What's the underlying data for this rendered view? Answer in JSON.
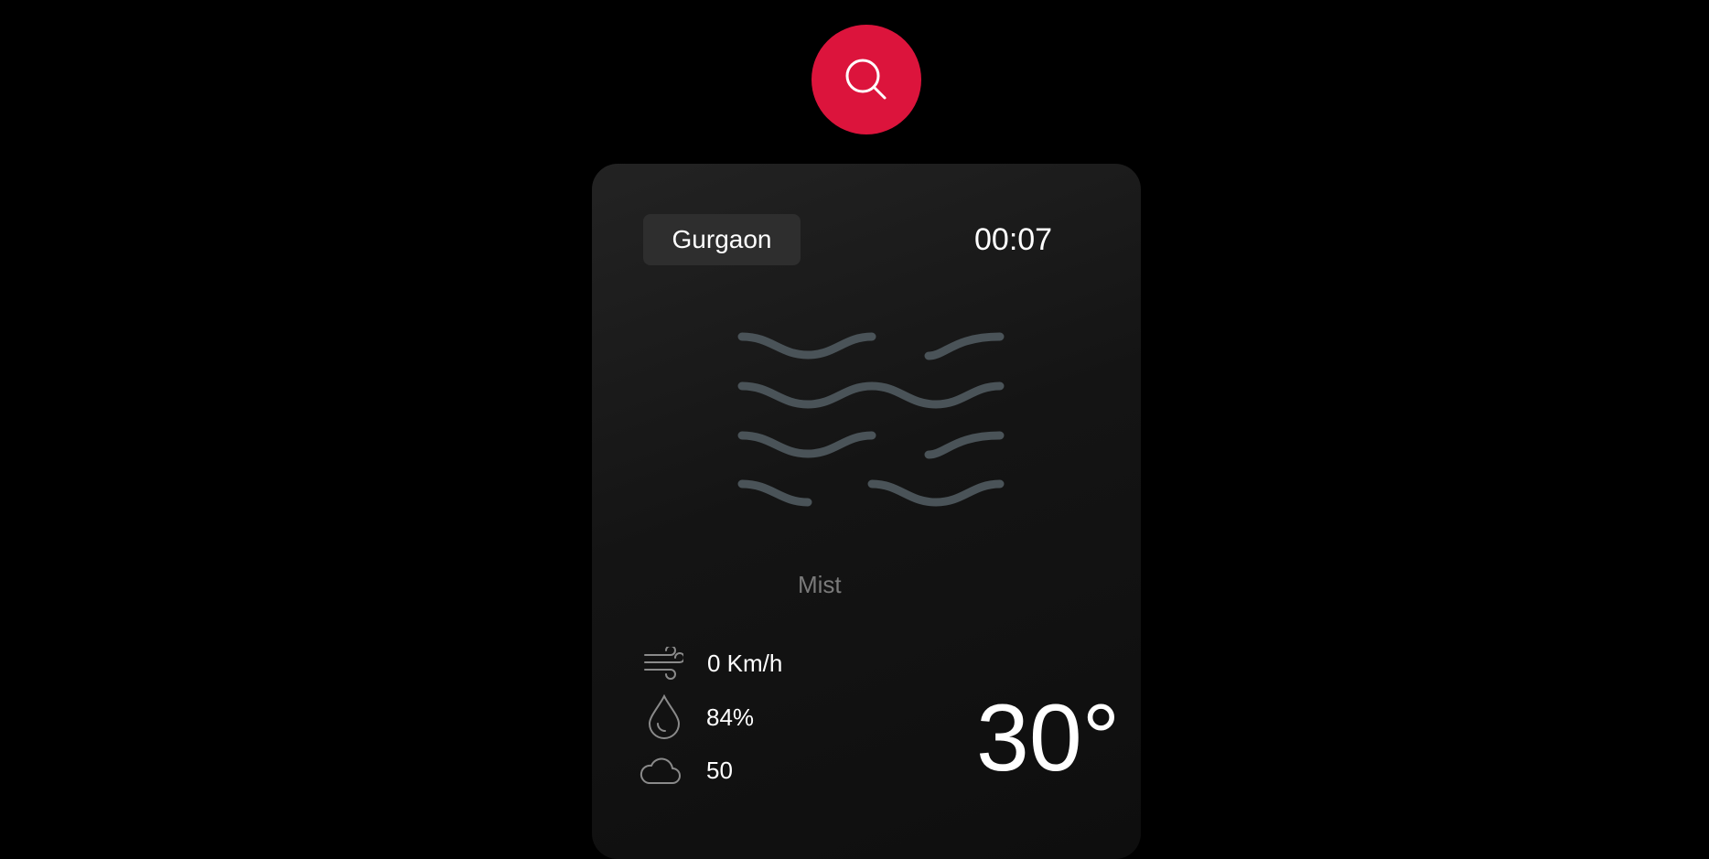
{
  "search": {
    "icon": "search-icon"
  },
  "card": {
    "city": "Gurgaon",
    "time": "00:07",
    "weather_icon": "mist-icon",
    "condition": "Mist",
    "stats": {
      "wind": {
        "icon": "wind-icon",
        "value": "0 Km/h"
      },
      "humidity": {
        "icon": "droplet-icon",
        "value": "84%"
      },
      "clouds": {
        "icon": "cloud-icon",
        "value": "50"
      }
    },
    "temperature": "30°"
  },
  "colors": {
    "accent": "#dc143c",
    "card_background": "#1a1a1a",
    "pill_background": "#2e2e2e",
    "mist_stroke": "#4a5358",
    "muted_text": "#7a7a7a"
  }
}
